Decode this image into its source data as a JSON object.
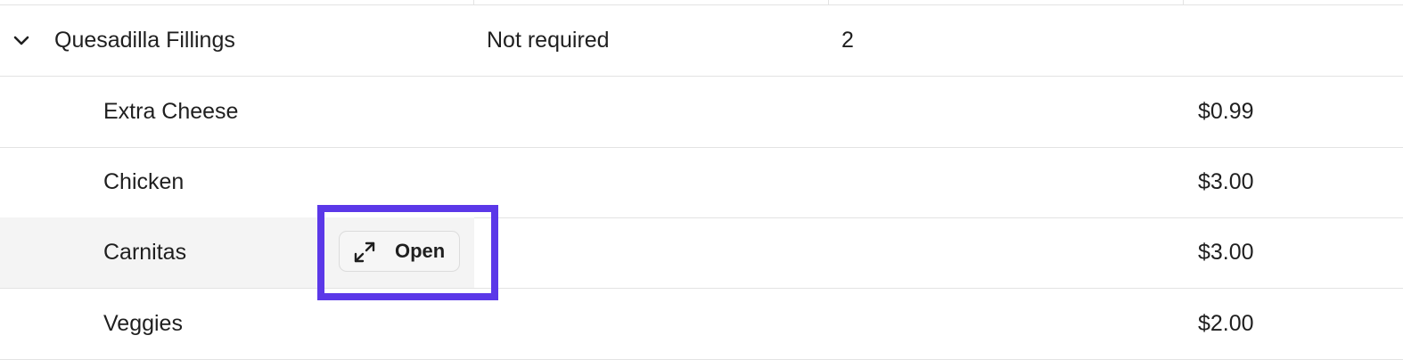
{
  "group": {
    "name": "Quesadilla Fillings",
    "required": "Not required",
    "count": "2",
    "expanded": true
  },
  "items": [
    {
      "name": "Extra Cheese",
      "price": "$0.99"
    },
    {
      "name": "Chicken",
      "price": "$3.00"
    },
    {
      "name": "Carnitas",
      "price": "$3.00"
    },
    {
      "name": "Veggies",
      "price": "$2.00"
    }
  ],
  "open_button": {
    "label": "Open",
    "icon": "expand-icon"
  },
  "colors": {
    "highlight": "#5b38e8",
    "hover_row": "#f4f4f4",
    "divider": "#e3e3e3"
  }
}
